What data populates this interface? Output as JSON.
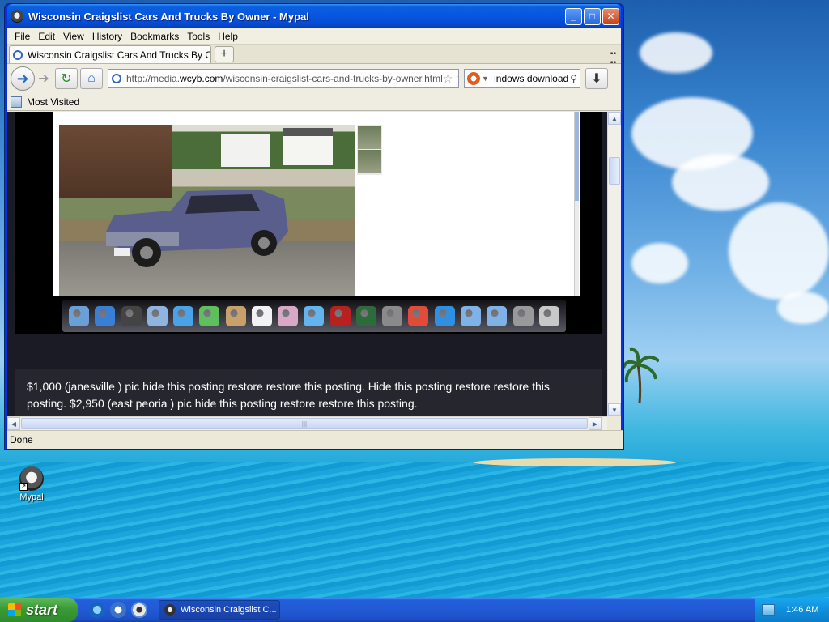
{
  "window": {
    "title": "Wisconsin Craigslist Cars And Trucks By Owner - Mypal",
    "controls": {
      "minimize": "_",
      "maximize": "□",
      "close": "✕"
    }
  },
  "menu": [
    "File",
    "Edit",
    "View",
    "History",
    "Bookmarks",
    "Tools",
    "Help"
  ],
  "tab": {
    "label": "Wisconsin Craigslist Cars And Trucks By Owner",
    "new_tab": "+"
  },
  "nav": {
    "url_prefix": "http://media.",
    "url_domain": "wcyb.com",
    "url_path": "/wisconsin-craigslist-cars-and-trucks-by-owner.html",
    "search_value": "windows download"
  },
  "bookmarks": {
    "most_visited": "Most Visited"
  },
  "page": {
    "listing_text": "$1,000 (janesville ) pic hide this posting restore restore this posting. Hide this posting restore restore this posting. $2,950 (east peoria ) pic hide this posting restore restore this posting."
  },
  "status": {
    "text": "Done"
  },
  "desktop": {
    "icon_label": "Mypal"
  },
  "taskbar": {
    "start_label": "start",
    "task_label": "Wisconsin Craigslist C...",
    "clock": "1:46 AM"
  },
  "colors": {
    "titlebar": "#0756df",
    "taskbar": "#245edb",
    "start_button": "#3b9b36",
    "page_background": "#1b1b25"
  },
  "dock_icons": [
    "finder-icon",
    "app-store-icon",
    "launchpad-icon",
    "mail-icon",
    "safari-icon",
    "facetime-icon",
    "contacts-icon",
    "calendar-icon",
    "photos-icon",
    "itunes-icon",
    "photo-booth-icon",
    "time-machine-icon",
    "system-preferences-icon",
    "chrome-icon",
    "quicktime-icon",
    "applications-folder-icon",
    "documents-folder-icon",
    "downloads-icon",
    "trash-icon"
  ]
}
